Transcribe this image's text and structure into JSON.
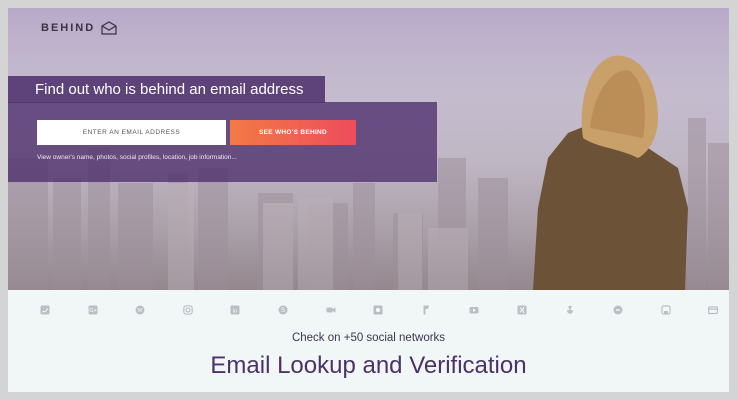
{
  "brand": {
    "name": "BEHIND",
    "logo_icon": "envelope-icon"
  },
  "hero": {
    "title": "Find out who is behind an email address",
    "email_placeholder": "ENTER AN EMAIL ADDRESS",
    "cta_label": "SEE WHO'S BEHIND",
    "hint": "View owner's name, photos, social profiles, location, job information..."
  },
  "social": {
    "icons": [
      "twitter-icon",
      "google-plus-icon",
      "wordpress-icon",
      "instagram-icon",
      "linkedin-icon",
      "skype-icon",
      "video-icon",
      "camera-icon",
      "foursquare-icon",
      "youtube-icon",
      "xing-icon",
      "angellist-icon",
      "blogger-icon",
      "github-icon",
      "card-icon"
    ],
    "caption": "Check on +50 social networks"
  },
  "section": {
    "headline": "Email Lookup and Verification"
  },
  "colors": {
    "accent_start": "#f27a45",
    "accent_end": "#ee4c5c",
    "band": "#50326e",
    "headline": "#4c3268"
  }
}
